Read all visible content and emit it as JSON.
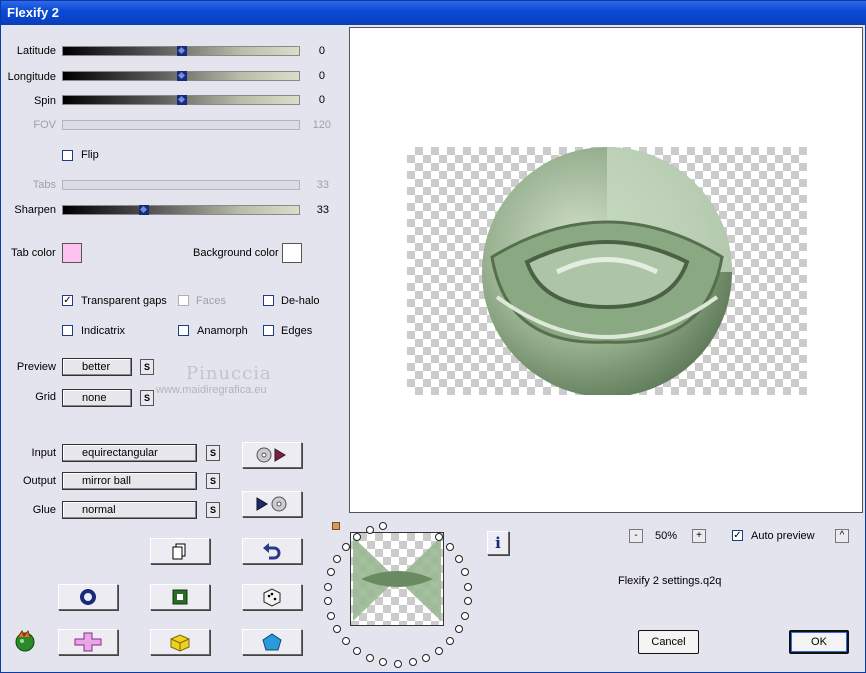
{
  "window": {
    "title": "Flexify 2"
  },
  "sliders": [
    {
      "label": "Latitude",
      "value": "0",
      "level": 0.5,
      "enabled": true
    },
    {
      "label": "Longitude",
      "value": "0",
      "level": 0.5,
      "enabled": true
    },
    {
      "label": "Spin",
      "value": "0",
      "level": 0.5,
      "enabled": true
    },
    {
      "label": "FOV",
      "value": "120",
      "enabled": false
    },
    {
      "label": "Tabs",
      "value": "33",
      "enabled": false
    },
    {
      "label": "Sharpen",
      "value": "33",
      "level": 0.33,
      "enabled": true
    }
  ],
  "flip": {
    "label": "Flip",
    "checked": false
  },
  "colors": {
    "tab_label": "Tab color",
    "tab_color": "#ffc2f0",
    "bg_label": "Background color",
    "bg_color": "#ffffff"
  },
  "options": {
    "transparent_gaps": "Transparent gaps",
    "faces": "Faces",
    "de_halo": "De-halo",
    "indicatrix": "Indicatrix",
    "anamorph": "Anamorph",
    "edges": "Edges"
  },
  "preview_quality": {
    "label": "Preview",
    "value": "better"
  },
  "grid": {
    "label": "Grid",
    "value": "none"
  },
  "input": {
    "label": "Input",
    "value": "equirectangular"
  },
  "output": {
    "label": "Output",
    "value": "mirror ball"
  },
  "glue": {
    "label": "Glue",
    "value": "normal"
  },
  "s_button_label": "S",
  "watermark": {
    "line1": "Pinuccia",
    "line2": "www.maidiregrafica.eu"
  },
  "zoom": {
    "minus": "-",
    "value": "50%",
    "plus": "+"
  },
  "auto_preview": {
    "label": "Auto preview",
    "checked": true,
    "toggle": "^"
  },
  "settings_file": "Flexify 2 settings.q2q",
  "buttons": {
    "cancel": "Cancel",
    "ok": "OK",
    "info": "i"
  }
}
